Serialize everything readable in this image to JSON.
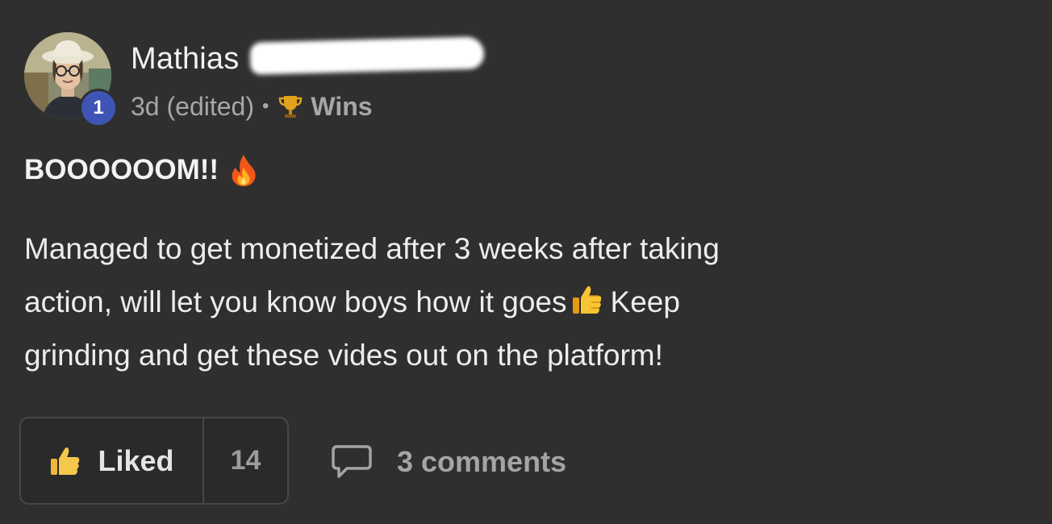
{
  "author": {
    "name": "Mathias",
    "level": "1"
  },
  "meta": {
    "time": "3d (edited)",
    "separator": "•",
    "category_icon": "trophy-icon",
    "category": "Wins"
  },
  "post": {
    "title": "BOOOOOOM!!",
    "title_icon": "fire-icon",
    "body_lines": [
      "Managed to get monetized after 3 weeks after taking",
      "action, will let you know boys how it goes",
      "Keep",
      "grinding and get these vides out on the platform!"
    ],
    "inline_icon": "thumbs-up-icon"
  },
  "actions": {
    "like_label": "Liked",
    "like_count": "14",
    "comments_label": "3 comments"
  },
  "colors": {
    "background": "#2f2f2f",
    "text": "#ededed",
    "muted": "#a7a7a7",
    "level_badge": "#3f55b5",
    "thumb": "#f5b82e"
  }
}
